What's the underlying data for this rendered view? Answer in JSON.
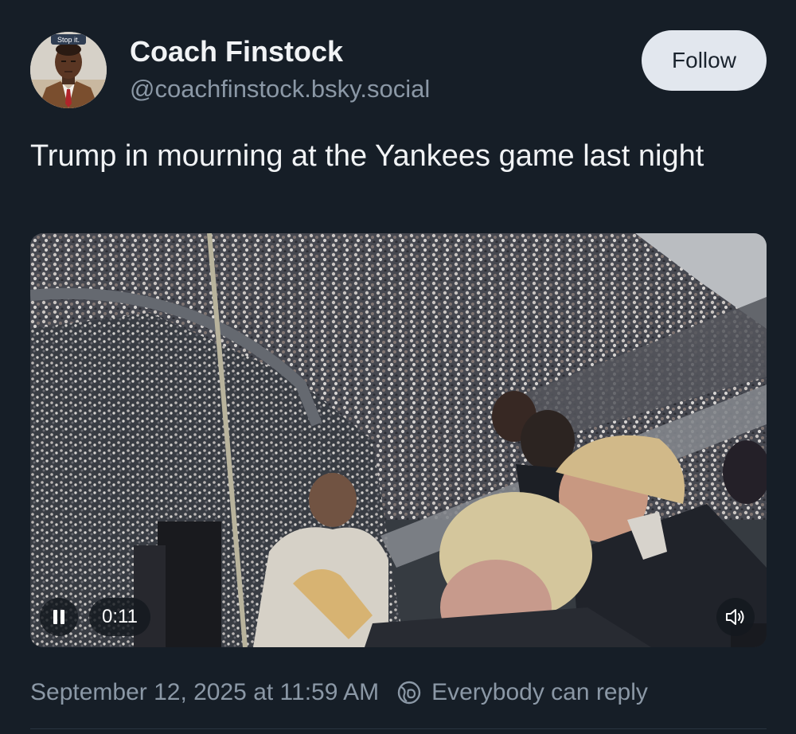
{
  "author": {
    "name": "Coach Finstock",
    "handle": "@coachfinstock.bsky.social",
    "avatar_caption": "Stop it."
  },
  "follow_label": "Follow",
  "post": {
    "text": "Trump in mourning at the Yankees game last night"
  },
  "video": {
    "time": "0:11",
    "state": "playing"
  },
  "meta": {
    "timestamp": "September 12, 2025 at 11:59 AM",
    "reply_setting": "Everybody can reply"
  },
  "icons": {
    "play_pause": "pause-icon",
    "volume": "volume-icon",
    "reply_setting": "globe-icon"
  },
  "colors": {
    "background": "#161e27",
    "follow_button": "#e2e7ee",
    "secondary_text": "#8b98a6"
  }
}
